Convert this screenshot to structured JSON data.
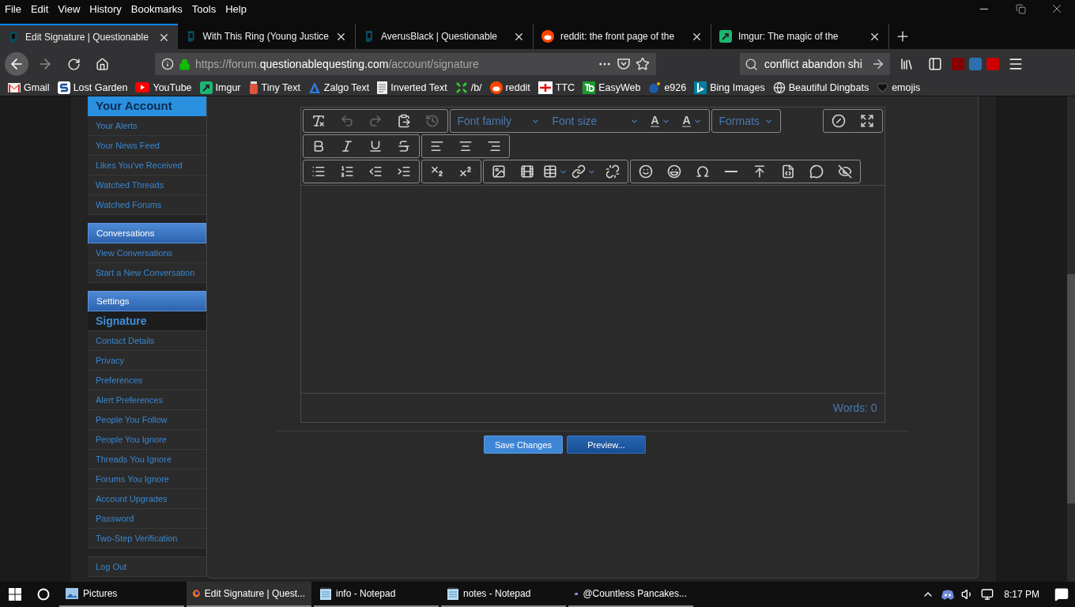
{
  "menu_bar": [
    "File",
    "Edit",
    "View",
    "History",
    "Bookmarks",
    "Tools",
    "Help"
  ],
  "tabs": [
    {
      "title": "Edit Signature | Questionable",
      "kind": "qq",
      "selected": true
    },
    {
      "title": "With This Ring (Young Justice",
      "kind": "qq",
      "selected": false
    },
    {
      "title": "AverusBlack | Questionable",
      "kind": "qq",
      "selected": false
    },
    {
      "title": "reddit: the front page of the",
      "kind": "reddit",
      "selected": false
    },
    {
      "title": "Imgur: The magic of the",
      "kind": "imgur",
      "selected": false
    }
  ],
  "address": {
    "prefix": "https://forum.",
    "domain": "questionablequesting.com",
    "path": "/account/signature"
  },
  "search": {
    "value": "conflict abandon shi"
  },
  "bookmarks": [
    {
      "label": "Gmail",
      "kind": "gmail"
    },
    {
      "label": "Lost Garden",
      "kind": "lostgarden"
    },
    {
      "label": "YouTube",
      "kind": "youtube"
    },
    {
      "label": "Imgur",
      "kind": "imgur"
    },
    {
      "label": "Tiny Text",
      "kind": "jar"
    },
    {
      "label": "Zalgo Text",
      "kind": "zalgo"
    },
    {
      "label": "Inverted Text",
      "kind": "doc"
    },
    {
      "label": "/b/",
      "kind": "clover"
    },
    {
      "label": "reddit",
      "kind": "reddit"
    },
    {
      "label": "TTC",
      "kind": "ttc"
    },
    {
      "label": "EasyWeb",
      "kind": "td"
    },
    {
      "label": "e926",
      "kind": "e926"
    },
    {
      "label": "Bing Images",
      "kind": "bing"
    },
    {
      "label": "Beautiful Dingbats",
      "kind": "globe"
    },
    {
      "label": "emojis",
      "kind": "heart"
    }
  ],
  "sidebar": [
    {
      "heading": "Your Account",
      "kind": "primary",
      "items": [
        {
          "label": "Your Alerts",
          "selected": false
        },
        {
          "label": "Your News Feed",
          "selected": false
        },
        {
          "label": "Likes You've Received",
          "selected": false
        },
        {
          "label": "Watched Threads",
          "selected": false
        },
        {
          "label": "Watched Forums",
          "selected": false
        }
      ]
    },
    {
      "heading": "Conversations",
      "kind": "secondary",
      "items": [
        {
          "label": "View Conversations",
          "selected": false
        },
        {
          "label": "Start a New Conversation",
          "selected": false
        }
      ]
    },
    {
      "heading": "Settings",
      "kind": "secondary",
      "items": [
        {
          "label": "Signature",
          "selected": true
        },
        {
          "label": "Contact Details",
          "selected": false
        },
        {
          "label": "Privacy",
          "selected": false
        },
        {
          "label": "Preferences",
          "selected": false
        },
        {
          "label": "Alert Preferences",
          "selected": false
        },
        {
          "label": "People You Follow",
          "selected": false
        },
        {
          "label": "People You Ignore",
          "selected": false
        },
        {
          "label": "Threads You Ignore",
          "selected": false
        },
        {
          "label": "Forums You Ignore",
          "selected": false
        },
        {
          "label": "Account Upgrades",
          "selected": false
        },
        {
          "label": "Password",
          "selected": false
        },
        {
          "label": "Two-Step Verification",
          "selected": false
        }
      ]
    },
    {
      "kind": "plain",
      "items": [
        {
          "label": "Log Out",
          "selected": false
        }
      ]
    }
  ],
  "editor": {
    "font_family": "Font family",
    "font_size": "Font size",
    "text_color": "A",
    "background_color": "A",
    "formats": "Formats",
    "word_count": "Words: 0"
  },
  "buttons": [
    {
      "label": "Save Changes",
      "kind": "primary"
    },
    {
      "label": "Preview...",
      "kind": "secondary"
    }
  ],
  "taskbar": {
    "items": [
      {
        "label": "Pictures",
        "kind": "folder",
        "selected": false
      },
      {
        "label": "Edit Signature | Quest...",
        "kind": "firefox",
        "selected": true
      },
      {
        "label": "info - Notepad",
        "kind": "notepad",
        "selected": false
      },
      {
        "label": "notes - Notepad",
        "kind": "notepad",
        "selected": false
      },
      {
        "label": "@Countless Pancakes...",
        "kind": "discord",
        "selected": false
      }
    ],
    "clock": "8:17 PM"
  }
}
